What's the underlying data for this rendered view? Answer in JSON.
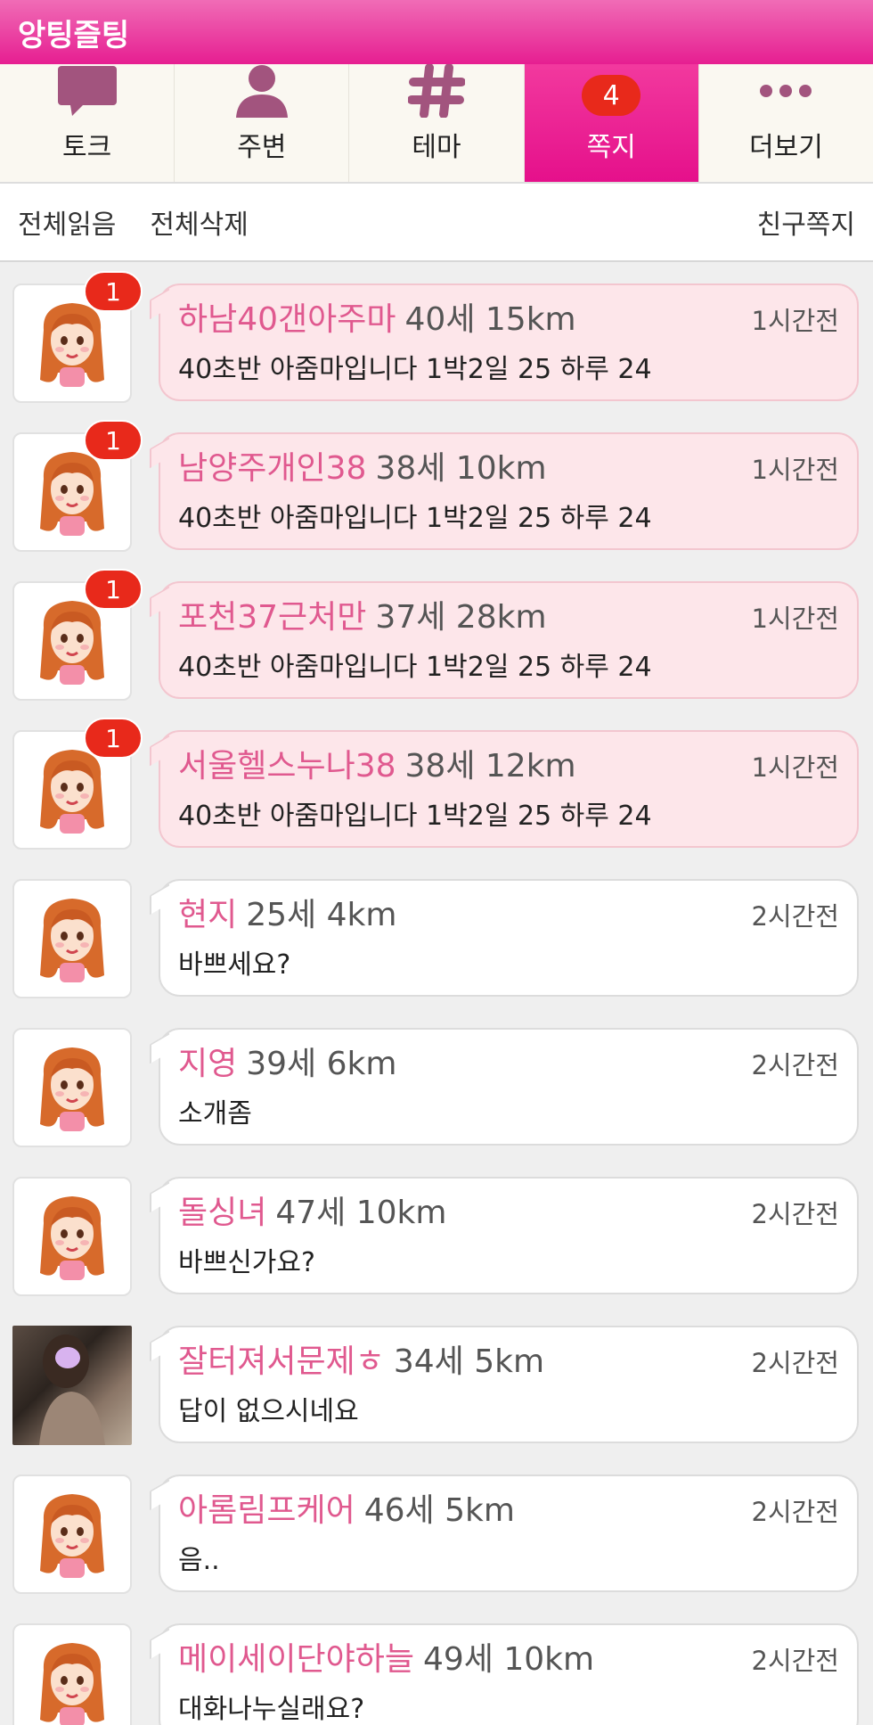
{
  "app": {
    "title": "앙팅즐팅"
  },
  "tabs": [
    {
      "label": "토크",
      "icon": "chat-bubble-icon"
    },
    {
      "label": "주변",
      "icon": "person-icon"
    },
    {
      "label": "테마",
      "icon": "hashtag-icon"
    },
    {
      "label": "쪽지",
      "icon": "message-icon",
      "badge": "4",
      "active": true
    },
    {
      "label": "더보기",
      "icon": "more-dots-icon"
    }
  ],
  "actions": {
    "read_all": "전체읽음",
    "delete_all": "전체삭제",
    "friend_msg": "친구쪽지"
  },
  "messages": [
    {
      "name": "하남40갠아주마",
      "info": "40세 15km",
      "time": "1시간전",
      "text": "40초반 아줌마입니다 1박2일 25 하루 24",
      "unread": "1",
      "avatar": "cartoon"
    },
    {
      "name": "남양주개인38",
      "info": "38세 10km",
      "time": "1시간전",
      "text": "40초반 아줌마입니다 1박2일 25 하루 24",
      "unread": "1",
      "avatar": "cartoon"
    },
    {
      "name": "포천37근처만",
      "info": "37세 28km",
      "time": "1시간전",
      "text": "40초반 아줌마입니다 1박2일 25 하루 24",
      "unread": "1",
      "avatar": "cartoon"
    },
    {
      "name": "서울헬스누나38",
      "info": "38세 12km",
      "time": "1시간전",
      "text": "40초반 아줌마입니다 1박2일 25 하루 24",
      "unread": "1",
      "avatar": "cartoon"
    },
    {
      "name": "현지",
      "info": "25세 4km",
      "time": "2시간전",
      "text": "바쁘세요?",
      "unread": "",
      "avatar": "cartoon"
    },
    {
      "name": "지영",
      "info": "39세 6km",
      "time": "2시간전",
      "text": "소개좀",
      "unread": "",
      "avatar": "cartoon"
    },
    {
      "name": "돌싱녀",
      "info": "47세 10km",
      "time": "2시간전",
      "text": "바쁘신가요?",
      "unread": "",
      "avatar": "cartoon"
    },
    {
      "name": "잘터져서문제ㅎ",
      "info": "34세 5km",
      "time": "2시간전",
      "text": "답이 없으시네요",
      "unread": "",
      "avatar": "photo"
    },
    {
      "name": "아롬림프케어",
      "info": "46세 5km",
      "time": "2시간전",
      "text": "음..",
      "unread": "",
      "avatar": "cartoon"
    },
    {
      "name": "메이세이단야하늘",
      "info": "49세 10km",
      "time": "2시간전",
      "text": "대화나누실래요?",
      "unread": "",
      "avatar": "cartoon"
    }
  ],
  "colors": {
    "accent": "#e61e91",
    "name": "#e0598f",
    "unread_bg": "#fde6ea",
    "badge": "#e8291b"
  }
}
